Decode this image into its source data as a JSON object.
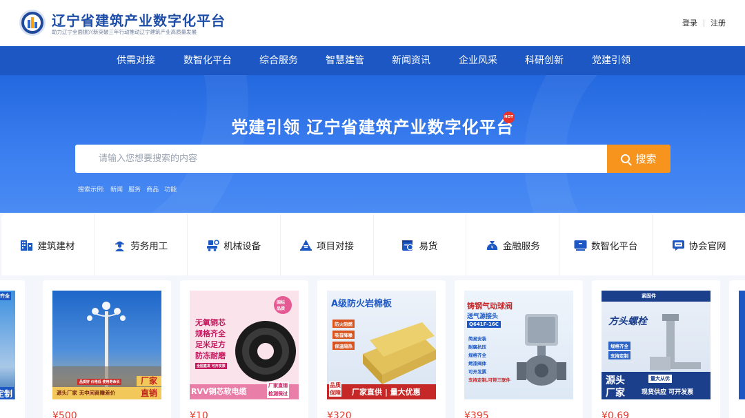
{
  "header": {
    "title": "辽宁省建筑产业数字化平台",
    "subtitle": "助力辽宁全面振兴新突破三年行动推动辽宁建筑产业高质量发展",
    "login": "登录",
    "register": "注册"
  },
  "nav": [
    "供需对接",
    "数智化平台",
    "综合服务",
    "智慧建管",
    "新闻资讯",
    "企业风采",
    "科研创新",
    "党建引领"
  ],
  "hero": {
    "title": "党建引领 辽宁省建筑产业数字化平台",
    "hot_badge": "HOT",
    "search_placeholder": "请输入您想要搜索的内容",
    "search_button": "搜索",
    "examples_label": "搜索示例:",
    "examples": [
      "新闻",
      "服务",
      "商品",
      "功能"
    ]
  },
  "categories": [
    {
      "label": "建筑建材",
      "icon": "building-materials-icon"
    },
    {
      "label": "劳务用工",
      "icon": "worker-icon"
    },
    {
      "label": "机械设备",
      "icon": "machinery-icon"
    },
    {
      "label": "项目对接",
      "icon": "project-icon"
    },
    {
      "label": "易货",
      "icon": "barter-icon"
    },
    {
      "label": "金融服务",
      "icon": "finance-icon"
    },
    {
      "label": "数智化平台",
      "icon": "digital-platform-icon"
    },
    {
      "label": "协会官网",
      "icon": "association-icon"
    }
  ],
  "products": [
    {
      "price": "¥500",
      "img_texts": [
        "源头厂家 无中间商赚差价",
        "厂家",
        "直销",
        "品质好 价格低 使用寿命长"
      ]
    },
    {
      "price": "¥10",
      "img_texts": [
        "无氧铜芯",
        "规格齐全",
        "足米足方",
        "防冻耐磨",
        "RVV铜芯软电缆",
        "厂家直销",
        "检测保过",
        "国标",
        "品质",
        "全国直发 可开发票"
      ]
    },
    {
      "price": "¥320",
      "img_texts": [
        "A级防火岩棉板",
        "防火阻燃",
        "吸音降噪",
        "保温隔热",
        "品质",
        "保障",
        "厂家直供 | 量大优惠"
      ]
    },
    {
      "price": "¥395",
      "img_texts": [
        "铸钢气动球阀",
        "送气源接头",
        "Q641F-16C",
        "简易安装",
        "耐腐抗压",
        "规格齐全",
        "烤漆阀体",
        "可开发票",
        "支持定制,可带三联件"
      ]
    },
    {
      "price": "¥0.69",
      "img_texts": [
        "紧固件",
        "方头螺栓",
        "规格齐全",
        "支持定制",
        "源头",
        "厂家",
        "量大从优",
        "现货供应 可开发票"
      ]
    }
  ],
  "partial_left": [
    "规格齐全",
    "持定制"
  ],
  "colors": {
    "primary": "#1c57c4",
    "accent": "#f7941d",
    "price": "#e53b2c"
  }
}
